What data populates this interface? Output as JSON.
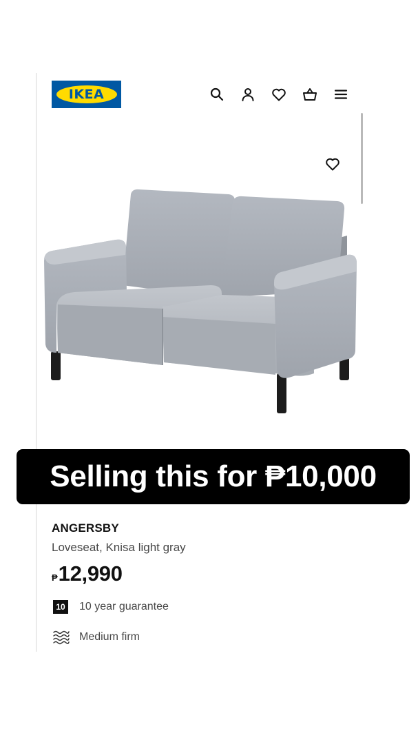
{
  "brand": {
    "logo_text": "IKEA",
    "blue": "#0058A3",
    "yellow": "#FFDB00"
  },
  "header": {
    "icons": [
      "search-icon",
      "profile-icon",
      "heart-icon",
      "basket-icon",
      "menu-icon"
    ]
  },
  "gallery": {
    "favorite_icon": "heart-icon"
  },
  "overlay": {
    "text": "Selling this for ₱10,000"
  },
  "product": {
    "name": "ANGERSBY",
    "description": "Loveseat, Knisa light gray",
    "price_currency": "₱",
    "price_amount": "12,990",
    "guarantee_years": "10",
    "guarantee_text": "10 year guarantee",
    "firmness_text": "Medium firm"
  }
}
